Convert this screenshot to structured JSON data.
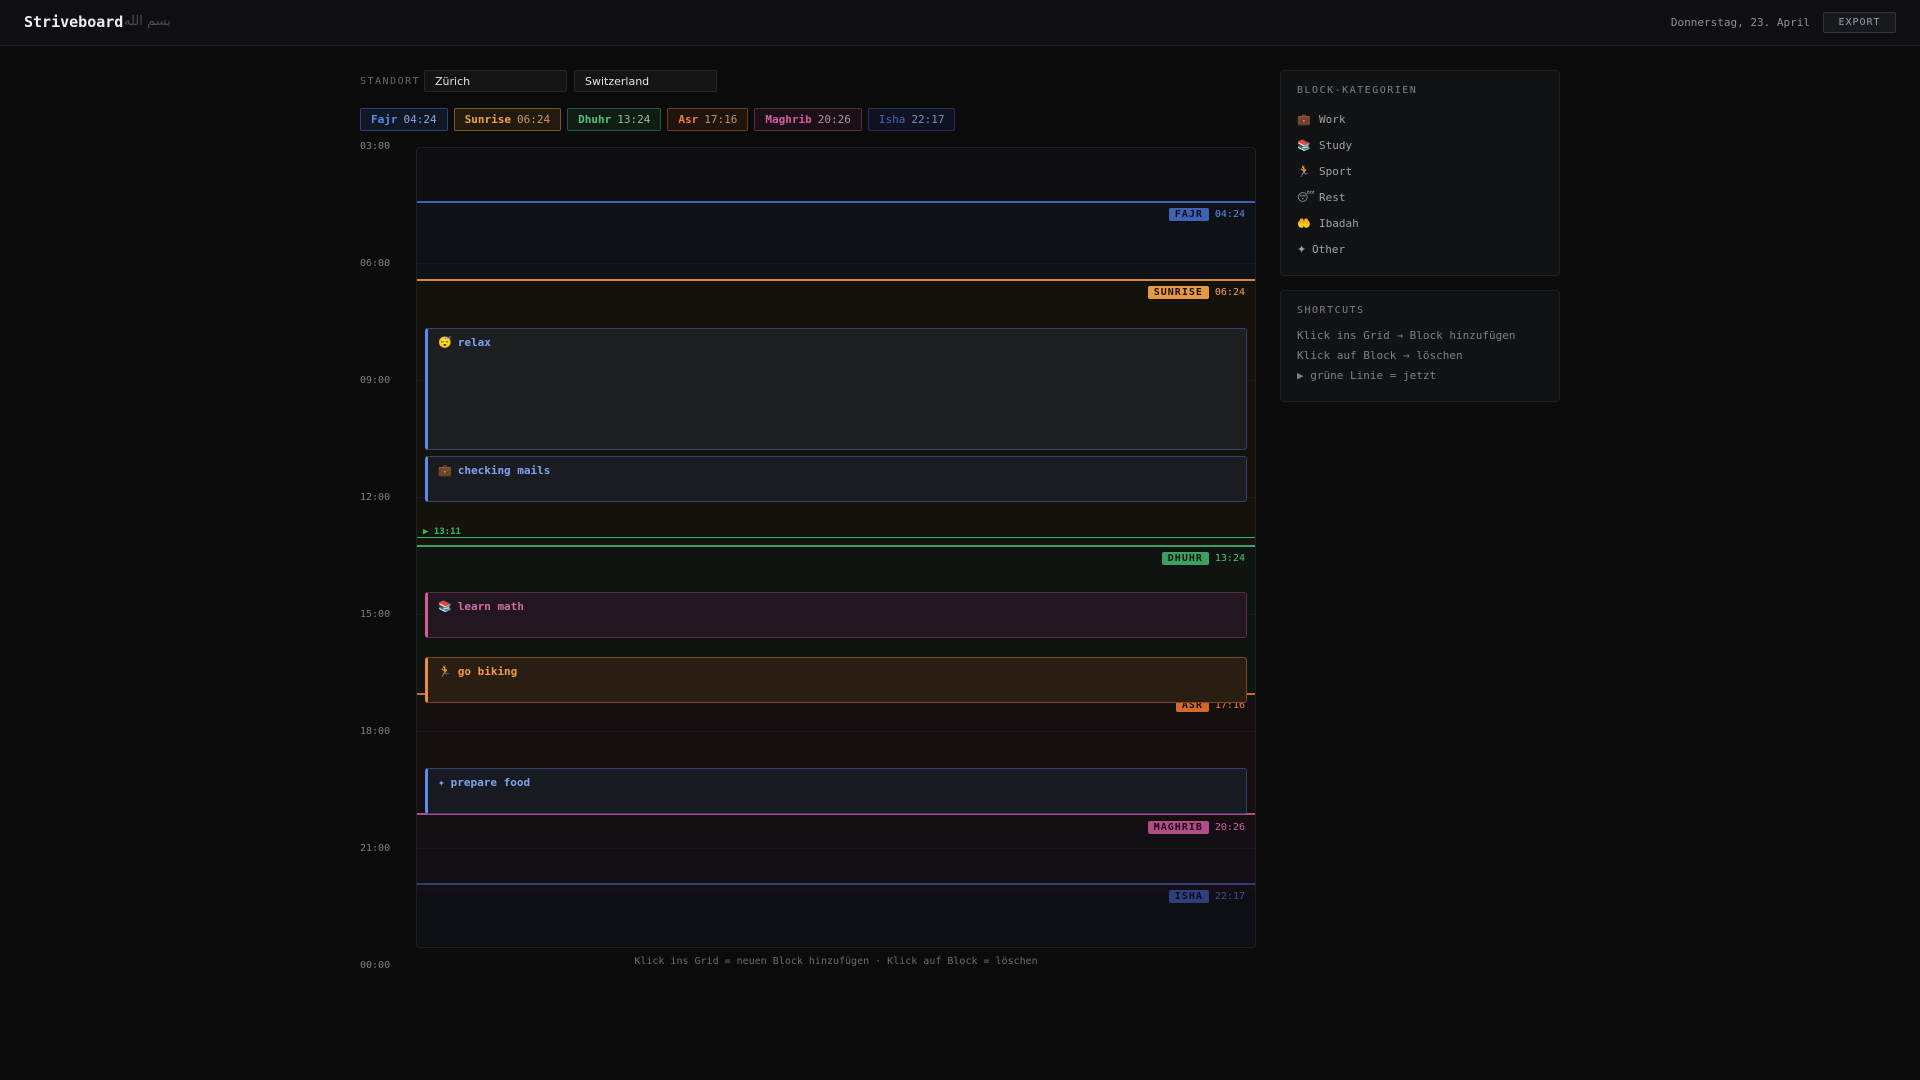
{
  "app": {
    "title": "Striveboard",
    "arabic": "بسم الله",
    "date": "Donnerstag, 23. April",
    "export_label": "EXPORT"
  },
  "location": {
    "label": "STANDORT",
    "city": "Zürich",
    "country": "Switzerland"
  },
  "prayers": [
    {
      "name": "Fajr",
      "tag": "FAJR",
      "time": "04:24",
      "color": "#5b8def"
    },
    {
      "name": "Sunrise",
      "tag": "SUNRISE",
      "time": "06:24",
      "color": "#f0a24b"
    },
    {
      "name": "Dhuhr",
      "tag": "DHUHR",
      "time": "13:24",
      "color": "#4fc37a"
    },
    {
      "name": "Asr",
      "tag": "ASR",
      "time": "17:16",
      "color": "#ef7f3a"
    },
    {
      "name": "Maghrib",
      "tag": "MAGHRIB",
      "time": "20:26",
      "color": "#d75aa0"
    },
    {
      "name": "Isha",
      "tag": "ISHA",
      "time": "22:17",
      "color": "#4259a8"
    }
  ],
  "hours": [
    "03:00",
    "06:00",
    "09:00",
    "12:00",
    "15:00",
    "18:00",
    "21:00",
    "00:00"
  ],
  "blocks": [
    {
      "label": "relax",
      "icon": "😴",
      "category": "rest"
    },
    {
      "label": "checking mails",
      "icon": "💼",
      "category": "work"
    },
    {
      "label": "learn math",
      "icon": "📚",
      "category": "study"
    },
    {
      "label": "go biking",
      "icon": "🏃",
      "category": "sport"
    },
    {
      "label": "prepare food",
      "icon": "✦",
      "category": "other"
    }
  ],
  "now": {
    "label": "▶ 13:11"
  },
  "hint": "Klick ins Grid = neuen Block hinzufügen · Klick auf Block = löschen",
  "categories": {
    "title": "BLOCK-KATEGORIEN",
    "items": [
      {
        "icon": "💼",
        "label": "Work"
      },
      {
        "icon": "📚",
        "label": "Study"
      },
      {
        "icon": "🏃",
        "label": "Sport"
      },
      {
        "icon": "😴",
        "label": "Rest"
      },
      {
        "icon": "🤲",
        "label": "Ibadah"
      },
      {
        "icon": "✦",
        "label": "Other"
      }
    ]
  },
  "shortcuts": {
    "title": "SHORTCUTS",
    "items": [
      "Klick ins Grid → Block hinzufügen",
      "Klick auf Block → löschen",
      "▶ grüne Linie = jetzt"
    ]
  },
  "colors": {
    "work": "#5b8def",
    "study": "#d75aa0",
    "sport": "#ef8a3a",
    "rest": "#5b8def",
    "other": "#5b8def",
    "now": "#2fbf5f"
  }
}
